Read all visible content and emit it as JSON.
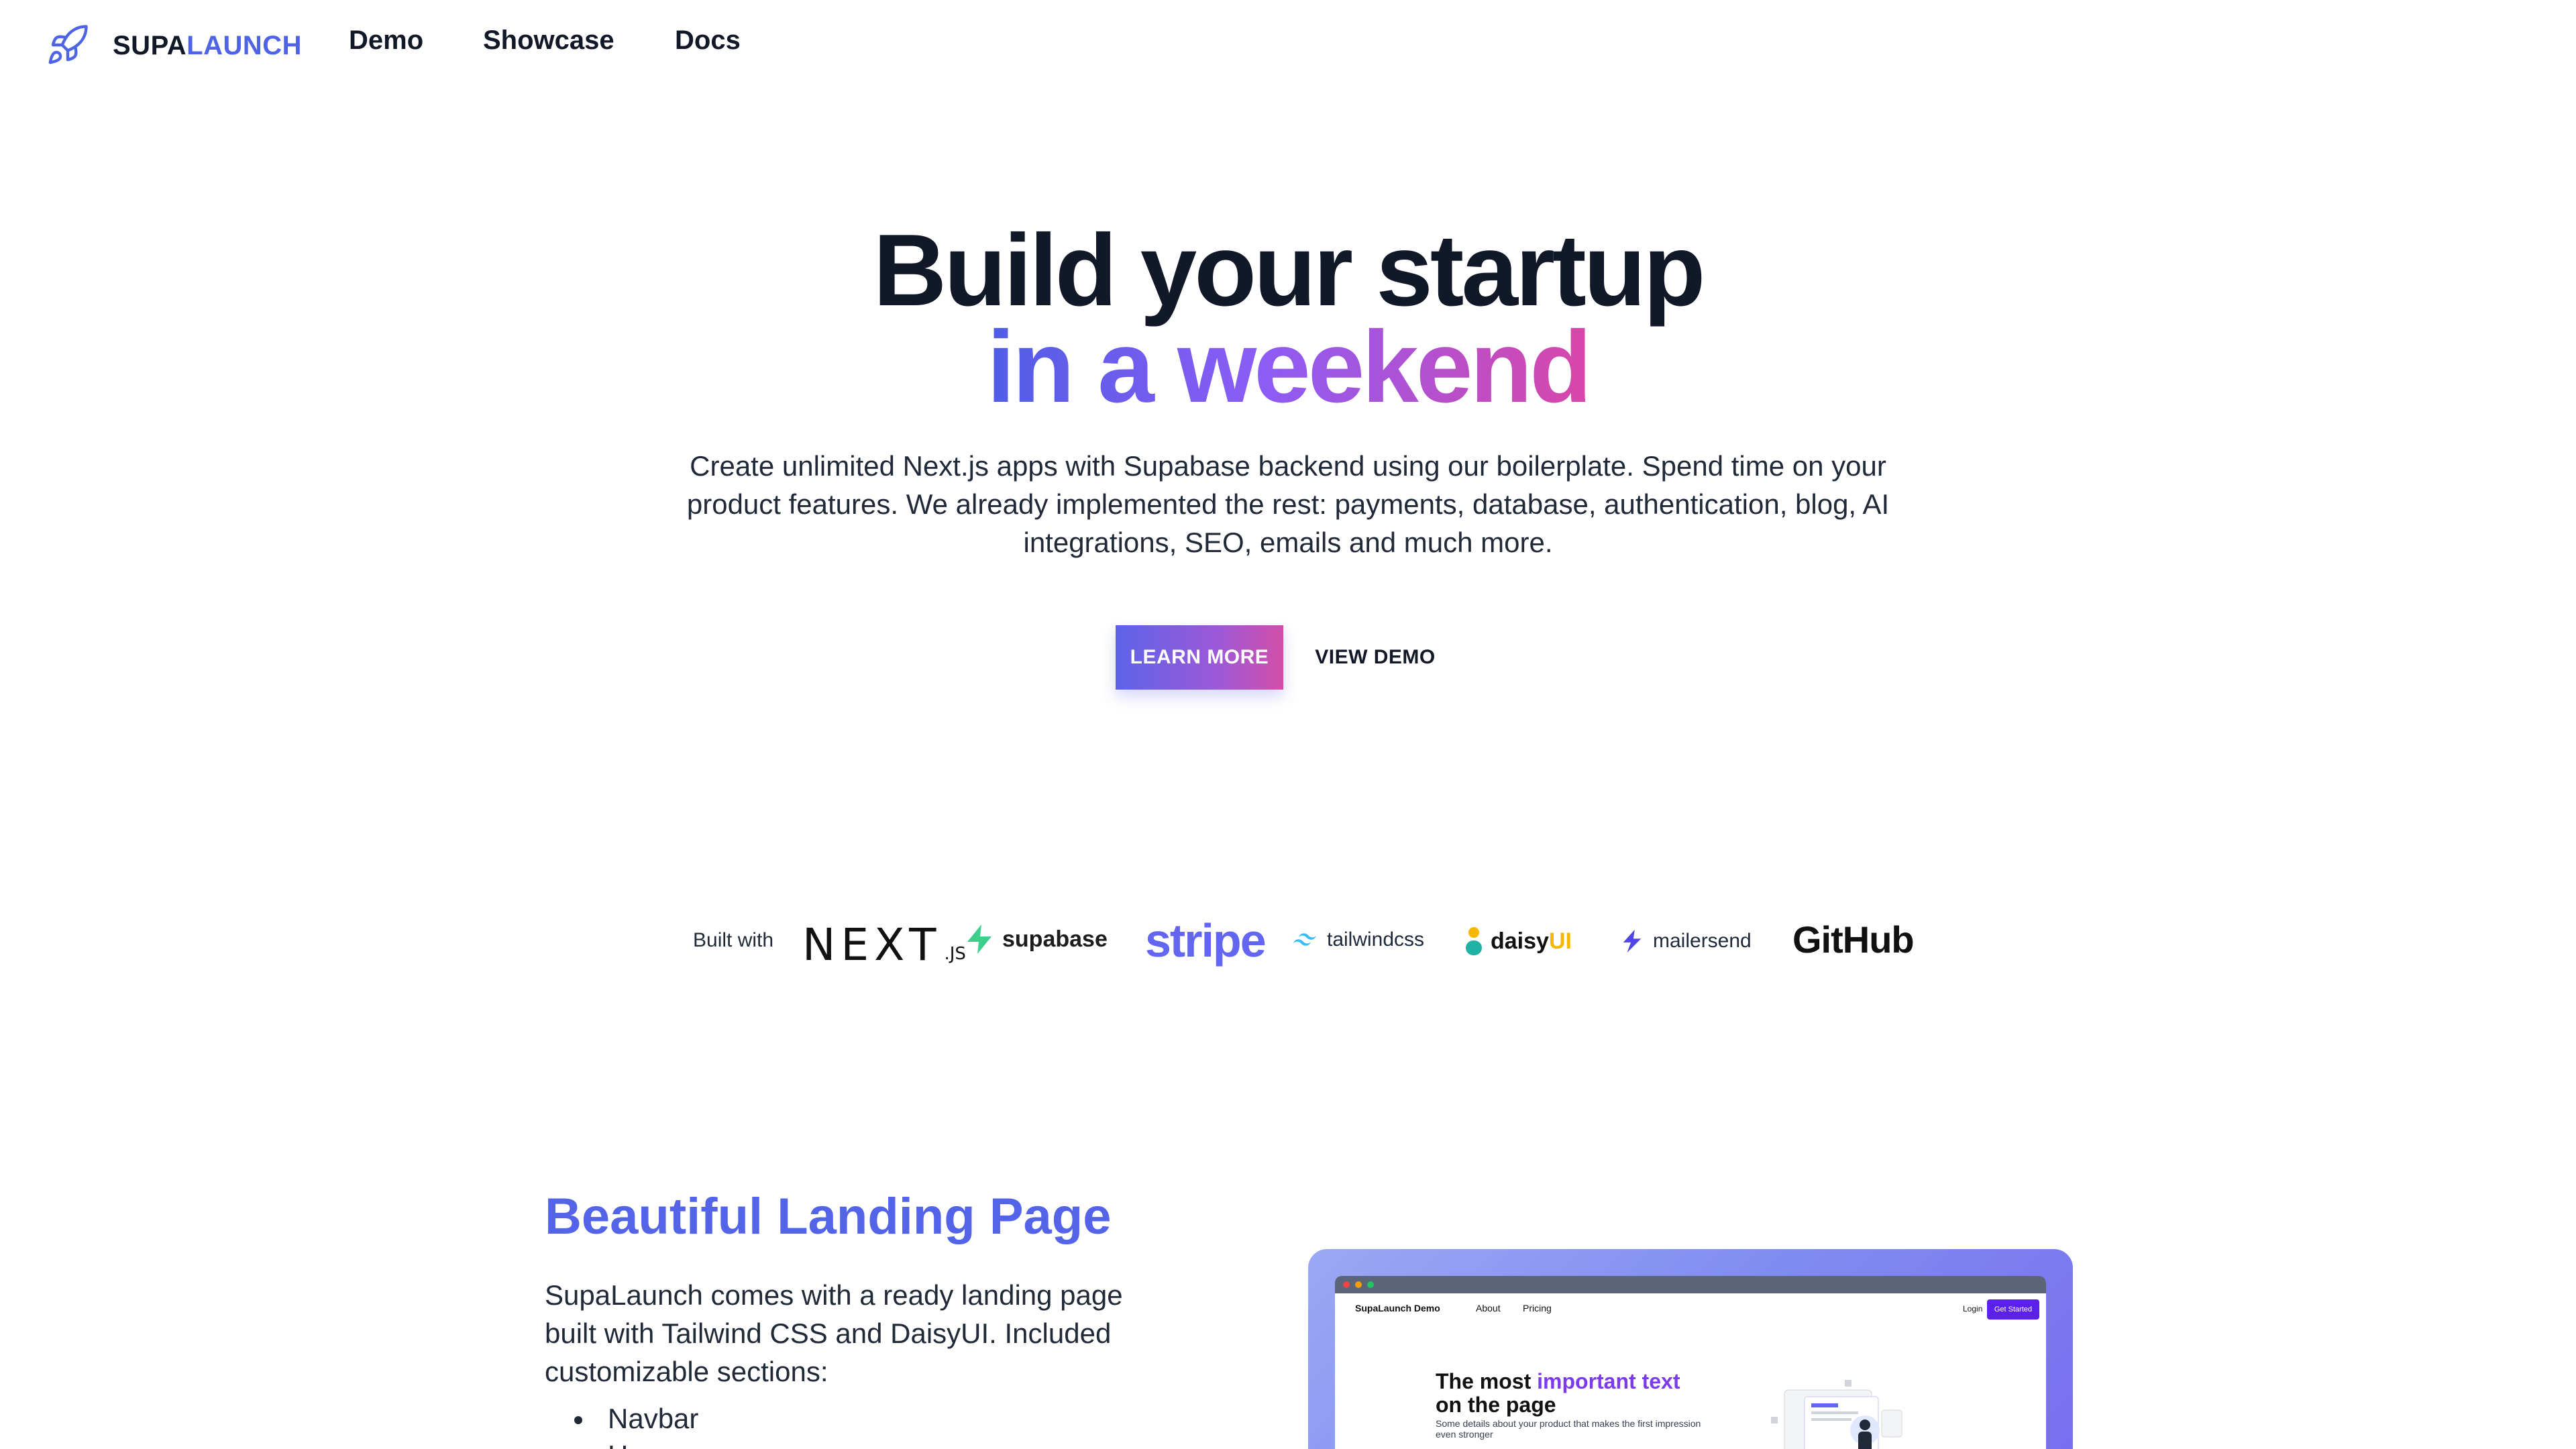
{
  "nav": {
    "logo_part1": "SUPA",
    "logo_part2": "LAUNCH",
    "links": [
      "Demo",
      "Showcase",
      "Docs"
    ]
  },
  "hero": {
    "title_line1": "Build your startup",
    "title_line2": "in a weekend",
    "subtitle": "Create unlimited Next.js apps with Supabase backend using our boilerplate. Spend time on your product features. We already implemented the rest: payments, database, authentication, blog, AI integrations, SEO, emails and much more.",
    "primary_button": "LEARN MORE",
    "secondary_button": "VIEW DEMO"
  },
  "built_with": {
    "label": "Built with",
    "brands": {
      "next": "NEXT",
      "next_suffix": ".JS",
      "supabase": "supabase",
      "stripe": "stripe",
      "tailwind": "tailwindcss",
      "daisy": "daisy",
      "daisy_suffix": "UI",
      "mailersend": "mailersend",
      "github": "GitHub"
    }
  },
  "feature": {
    "title": "Beautiful Landing Page",
    "description": "SupaLaunch comes with a ready landing page built with Tailwind CSS and DaisyUI. Included customizable sections:",
    "items": [
      "Navbar",
      "Hero"
    ]
  },
  "mockup": {
    "brand": "SupaLaunch Demo",
    "links": [
      "About",
      "Pricing"
    ],
    "login": "Login",
    "cta": "Get Started",
    "heading_pre": "The most ",
    "heading_highlight": "important text",
    "heading_line2": "on the page",
    "paragraph": "Some details about your product that makes the first impression even stronger"
  },
  "colors": {
    "accent": "#4f63e7",
    "gradient_start": "#4f5de6",
    "gradient_end": "#d946a8",
    "text": "#111827"
  }
}
